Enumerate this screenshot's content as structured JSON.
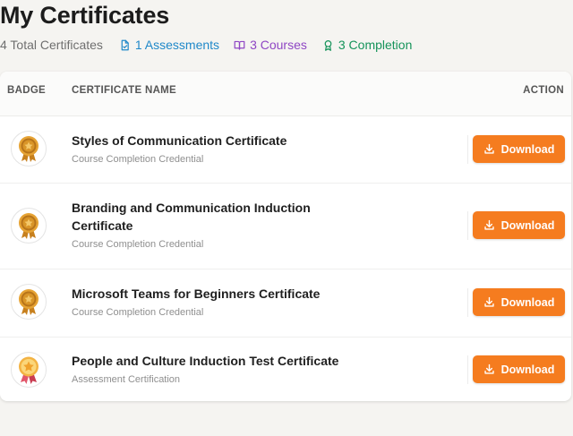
{
  "page": {
    "title": "My Certificates"
  },
  "stats": {
    "total": "4 Total Certificates",
    "assessments": "1 Assessments",
    "courses": "3 Courses",
    "completion": "3 Completion"
  },
  "table": {
    "headers": {
      "badge": "BADGE",
      "name": "CERTIFICATE NAME",
      "action": "ACTION"
    },
    "rows": [
      {
        "name": "Styles of Communication Certificate",
        "type": "Course Completion Credential",
        "badge": "gold-medal-icon",
        "action": "Download"
      },
      {
        "name": "Branding and Communication Induction Certificate",
        "type": "Course Completion Credential",
        "badge": "gold-medal-icon",
        "action": "Download"
      },
      {
        "name": "Microsoft Teams for Beginners Certificate",
        "type": "Course Completion Credential",
        "badge": "gold-medal-icon",
        "action": "Download"
      },
      {
        "name": "People and Culture Induction Test Certificate",
        "type": "Assessment Certification",
        "badge": "star-ribbon-icon",
        "action": "Download"
      }
    ]
  },
  "colors": {
    "accent": "#f57c1f",
    "assessments": "#1f88c9",
    "courses": "#8f46c4",
    "completion": "#15935a"
  }
}
